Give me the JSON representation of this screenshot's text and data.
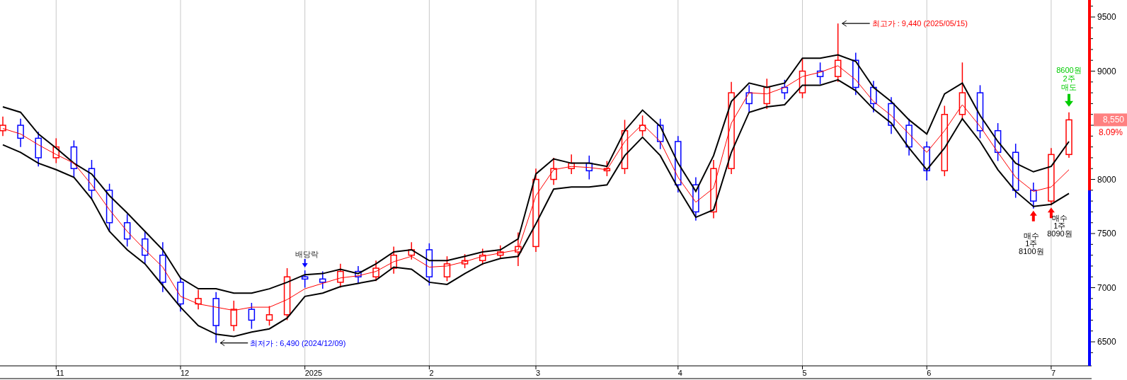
{
  "chart": {
    "chart_data": {
      "type": "candlestick",
      "categories": [
        null,
        null,
        null,
        "11",
        null,
        null,
        null,
        null,
        null,
        null,
        "12",
        null,
        null,
        null,
        null,
        null,
        null,
        "2025",
        null,
        null,
        null,
        null,
        null,
        null,
        "2",
        null,
        null,
        null,
        null,
        null,
        "3",
        null,
        null,
        null,
        null,
        null,
        null,
        null,
        "4",
        null,
        null,
        null,
        null,
        null,
        null,
        "5",
        null,
        null,
        null,
        null,
        null,
        null,
        "6",
        null,
        null,
        null,
        null,
        null,
        null,
        "7",
        null
      ],
      "ylim": [
        6278,
        9657
      ],
      "yticks": [
        6500,
        7000,
        7500,
        8000,
        9000,
        9500
      ],
      "ohlc": [
        [
          8450,
          8580,
          8400,
          8500
        ],
        [
          8500,
          8560,
          8300,
          8380
        ],
        [
          8380,
          8440,
          8120,
          8200
        ],
        [
          8200,
          8380,
          8150,
          8300
        ],
        [
          8300,
          8360,
          8020,
          8100
        ],
        [
          8100,
          8180,
          7820,
          7900
        ],
        [
          7900,
          7960,
          7520,
          7600
        ],
        [
          7600,
          7680,
          7380,
          7450
        ],
        [
          7450,
          7520,
          7220,
          7300
        ],
        [
          7300,
          7420,
          6960,
          7050
        ],
        [
          7050,
          7100,
          6780,
          6850
        ],
        [
          6850,
          6980,
          6800,
          6900
        ],
        [
          6900,
          6960,
          6490,
          6650
        ],
        [
          6650,
          6880,
          6600,
          6800
        ],
        [
          6800,
          6860,
          6620,
          6700
        ],
        [
          6700,
          6830,
          6650,
          6750
        ],
        [
          6750,
          7180,
          6700,
          7100
        ],
        [
          7100,
          7160,
          7000,
          7080
        ],
        [
          7080,
          7150,
          6990,
          7050
        ],
        [
          7050,
          7220,
          7000,
          7150
        ],
        [
          7150,
          7200,
          7040,
          7100
        ],
        [
          7100,
          7250,
          7060,
          7180
        ],
        [
          7180,
          7380,
          7130,
          7300
        ],
        [
          7300,
          7420,
          7260,
          7350
        ],
        [
          7350,
          7410,
          7020,
          7100
        ],
        [
          7100,
          7290,
          7060,
          7220
        ],
        [
          7220,
          7310,
          7180,
          7250
        ],
        [
          7250,
          7360,
          7210,
          7300
        ],
        [
          7300,
          7390,
          7270,
          7330
        ],
        [
          7330,
          7510,
          7200,
          7380
        ],
        [
          7380,
          8100,
          7330,
          8000
        ],
        [
          8000,
          8200,
          7950,
          8100
        ],
        [
          8100,
          8230,
          8050,
          8150
        ],
        [
          8150,
          8220,
          8000,
          8080
        ],
        [
          8080,
          8170,
          8030,
          8100
        ],
        [
          8100,
          8550,
          8050,
          8450
        ],
        [
          8450,
          8590,
          8400,
          8500
        ],
        [
          8500,
          8560,
          8280,
          8350
        ],
        [
          8350,
          8400,
          7880,
          7950
        ],
        [
          7950,
          8020,
          7620,
          7700
        ],
        [
          7700,
          8180,
          7640,
          8100
        ],
        [
          8100,
          8900,
          8050,
          8800
        ],
        [
          8800,
          8870,
          8620,
          8700
        ],
        [
          8700,
          8930,
          8650,
          8850
        ],
        [
          8850,
          8920,
          8740,
          8800
        ],
        [
          8800,
          9120,
          8750,
          9000
        ],
        [
          9000,
          9080,
          8880,
          8950
        ],
        [
          8950,
          9440,
          8900,
          9100
        ],
        [
          9100,
          9170,
          8780,
          8850
        ],
        [
          8850,
          8910,
          8620,
          8700
        ],
        [
          8700,
          8760,
          8420,
          8500
        ],
        [
          8500,
          8560,
          8220,
          8300
        ],
        [
          8300,
          8350,
          7990,
          8080
        ],
        [
          8080,
          8680,
          8030,
          8600
        ],
        [
          8600,
          9080,
          8550,
          8800
        ],
        [
          8800,
          8870,
          8380,
          8450
        ],
        [
          8450,
          8520,
          8170,
          8250
        ],
        [
          8250,
          8330,
          7830,
          7900
        ],
        [
          7900,
          7970,
          7730,
          7800
        ],
        [
          7800,
          8290,
          7760,
          8230
        ],
        [
          8230,
          8620,
          8200,
          8550
        ]
      ],
      "grid": true,
      "series": [
        {
          "type": "line",
          "color": "#000000",
          "values": [
            8670,
            8620,
            8420,
            8290,
            8150,
            8050,
            7850,
            7690,
            7520,
            7350,
            7090,
            6990,
            6990,
            6950,
            6950,
            6990,
            7050,
            7120,
            7130,
            7170,
            7130,
            7220,
            7330,
            7350,
            7250,
            7250,
            7290,
            7330,
            7350,
            7450,
            8050,
            8190,
            8150,
            8150,
            8120,
            8450,
            8640,
            8490,
            8150,
            7890,
            8220,
            8720,
            8890,
            8850,
            8890,
            9120,
            9120,
            9150,
            9090,
            8850,
            8720,
            8550,
            8420,
            8790,
            8890,
            8590,
            8350,
            8150,
            8070,
            8120,
            8350
          ]
        },
        {
          "type": "line",
          "color": "#ff0000",
          "values": [
            8470,
            8420,
            8320,
            8230,
            8150,
            7950,
            7720,
            7520,
            7350,
            7190,
            6920,
            6850,
            6820,
            6790,
            6820,
            6820,
            6890,
            6990,
            7040,
            7090,
            7110,
            7150,
            7240,
            7290,
            7190,
            7200,
            7240,
            7290,
            7320,
            7350,
            7850,
            8090,
            8120,
            8110,
            8090,
            8350,
            8510,
            8350,
            8020,
            7790,
            7920,
            8520,
            8800,
            8790,
            8850,
            8950,
            8990,
            9050,
            8920,
            8720,
            8590,
            8420,
            8250,
            8450,
            8690,
            8490,
            8250,
            8020,
            7890,
            7930,
            8090
          ]
        },
        {
          "type": "line",
          "color": "#000000",
          "values": [
            8320,
            8250,
            8150,
            8090,
            8020,
            7820,
            7520,
            7350,
            7220,
            7020,
            6820,
            6650,
            6570,
            6550,
            6590,
            6620,
            6720,
            6920,
            6950,
            7010,
            7040,
            7070,
            7190,
            7170,
            7050,
            7030,
            7130,
            7220,
            7270,
            7290,
            7590,
            7910,
            7930,
            7930,
            7950,
            8220,
            8390,
            8220,
            7920,
            7650,
            7720,
            8250,
            8620,
            8670,
            8690,
            8870,
            8870,
            8920,
            8820,
            8650,
            8520,
            8290,
            8090,
            8290,
            8560,
            8350,
            8090,
            7890,
            7750,
            7770,
            7870
          ]
        }
      ],
      "annotations": [
        "최고가 : 9,440 (2025/05/15)",
        "최저가 : 6,490 (2024/12/09)",
        "배당락"
      ]
    },
    "signals": [
      {
        "kind": "sell",
        "lines": [
          "8600원",
          "2주",
          "매도"
        ]
      },
      {
        "kind": "buy",
        "lines": [
          "매수",
          "1주",
          "8090원"
        ]
      },
      {
        "kind": "buy",
        "lines": [
          "매수",
          "1주",
          "8100원"
        ]
      }
    ],
    "last_price": {
      "price": "8,550",
      "change": "8.09%"
    }
  }
}
